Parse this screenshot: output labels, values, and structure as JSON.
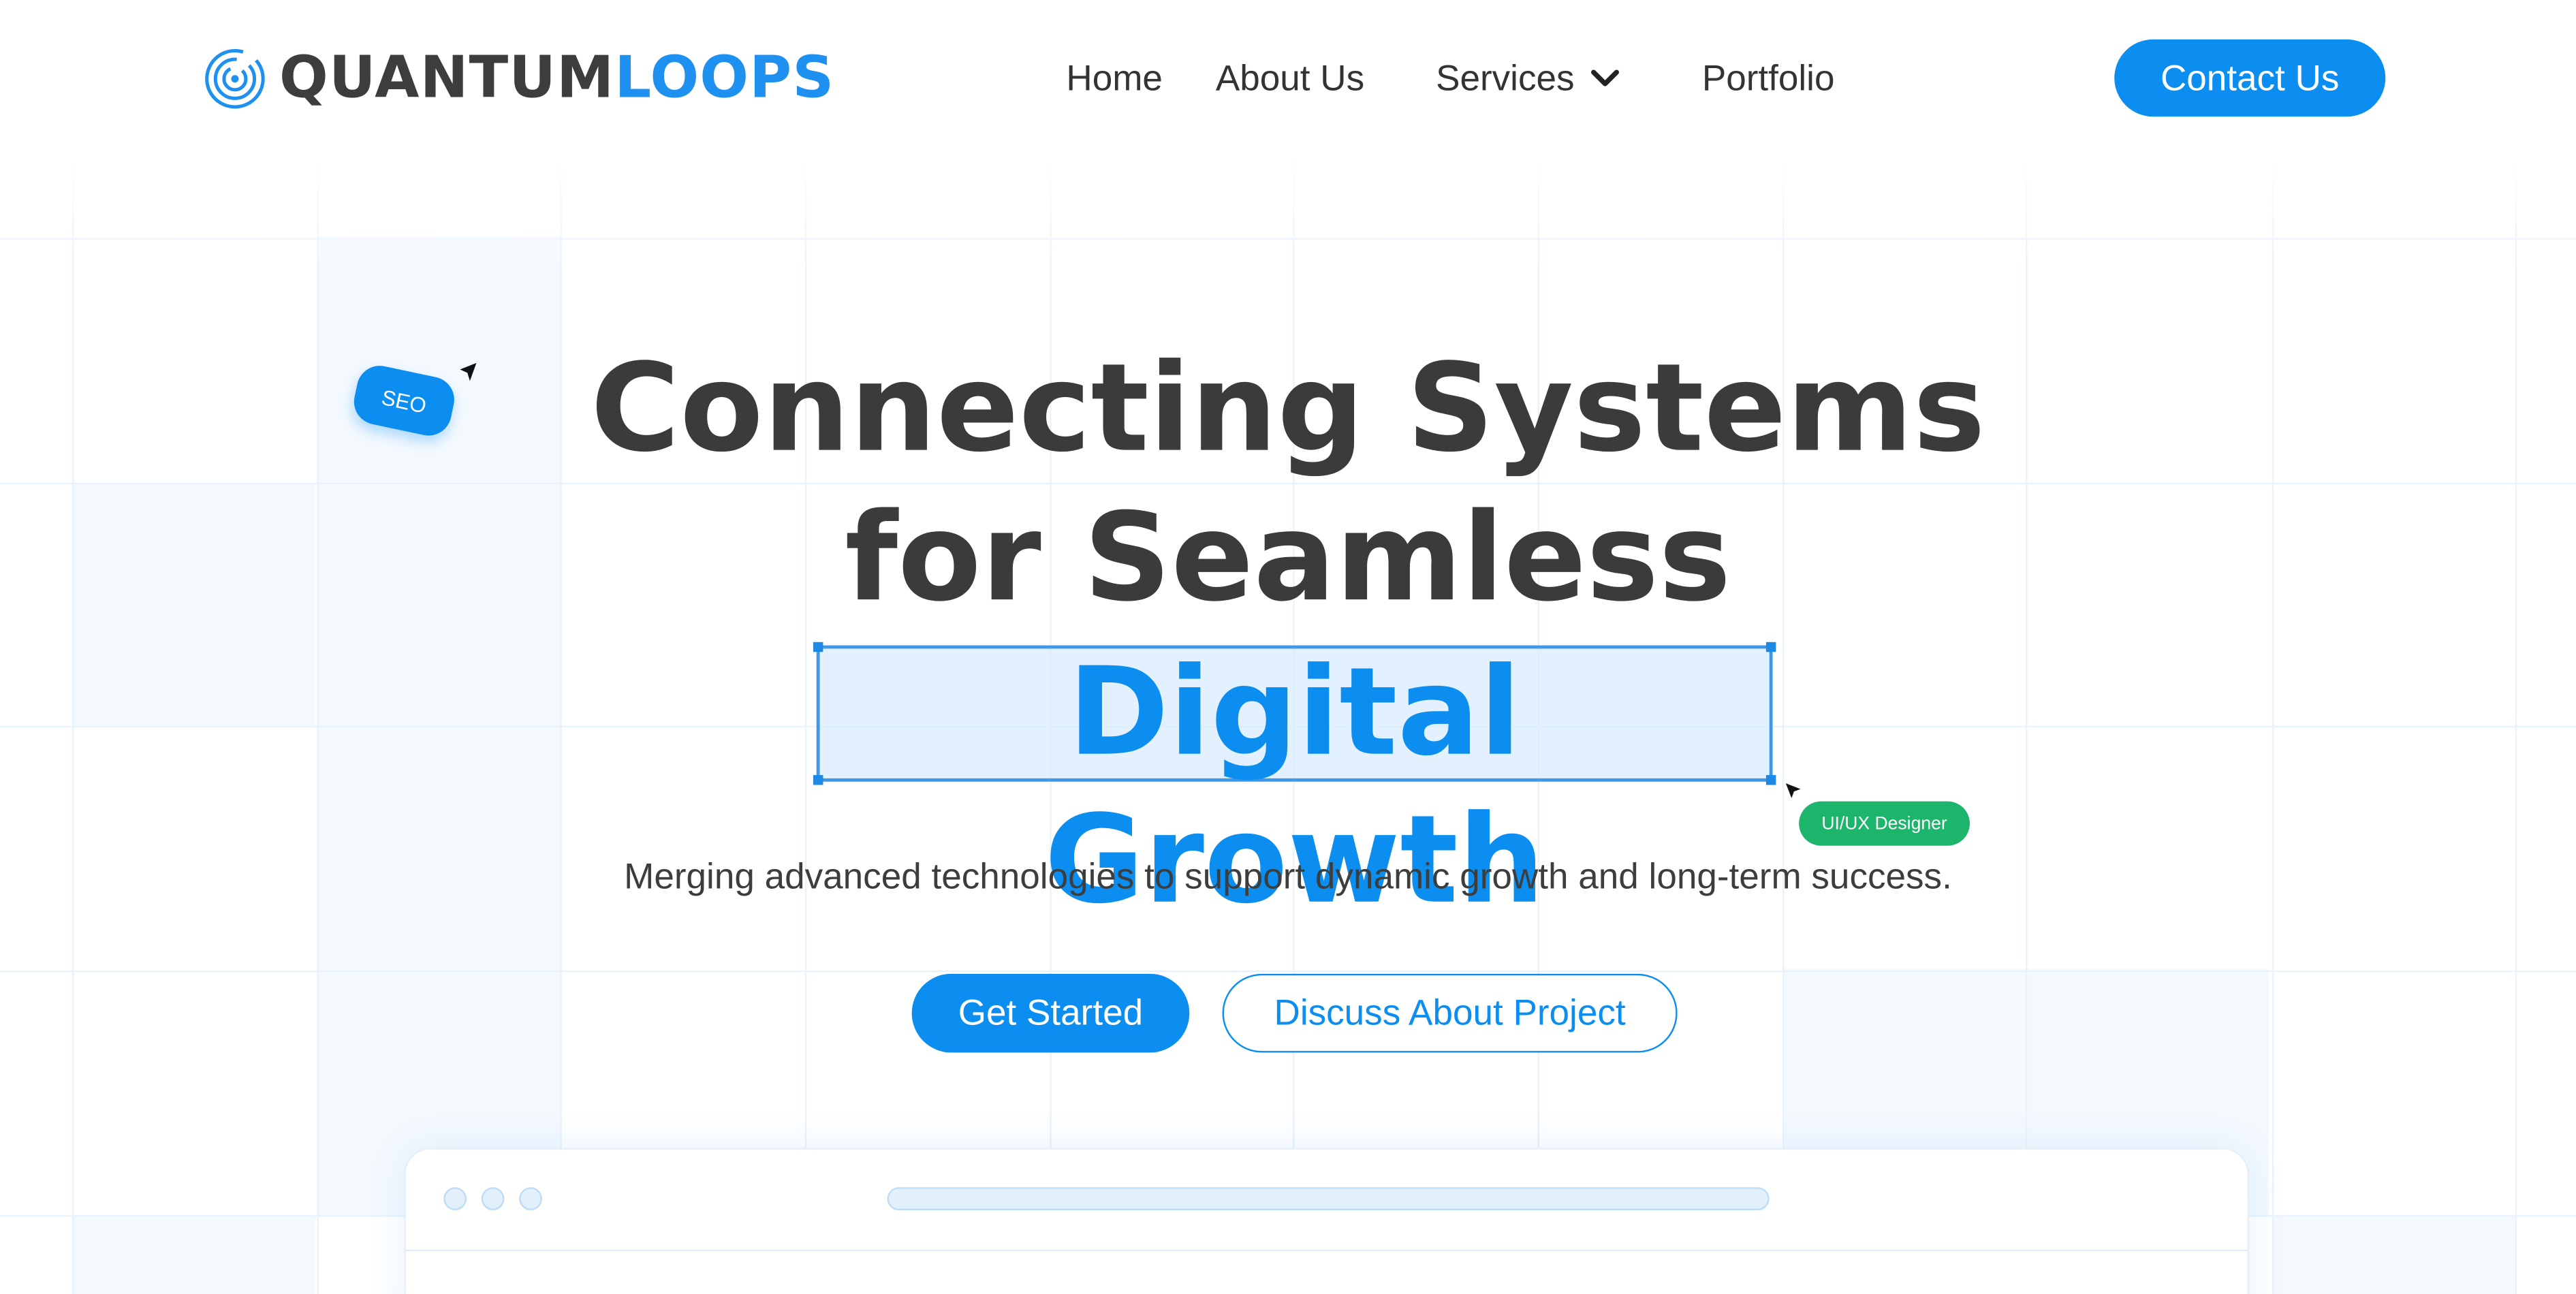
{
  "header": {
    "logo_part1": "QUANTUM",
    "logo_part2": "LOOPS",
    "nav": [
      "Home",
      "About Us",
      "Services",
      "Portfolio"
    ],
    "contact_label": "Contact Us"
  },
  "hero": {
    "title_line1": "Connecting Systems",
    "title_line2": "for Seamless",
    "title_highlight": "Digital Growth",
    "subtitle": "Merging advanced technologies to support dynamic growth and long-term success.",
    "seo_tag": "SEO",
    "designer_tag": "UI/UX Designer",
    "primary_button": "Get Started",
    "secondary_button": "Discuss About Project"
  },
  "icons": {
    "logo": "concentric-circles-icon",
    "services_dropdown": "chevron-down-icon",
    "cursors": "cursor-arrow-icon"
  },
  "colors": {
    "accent": "#0b8ef0",
    "text_dark": "#3b3b3b",
    "tag_green": "#1db46b"
  }
}
